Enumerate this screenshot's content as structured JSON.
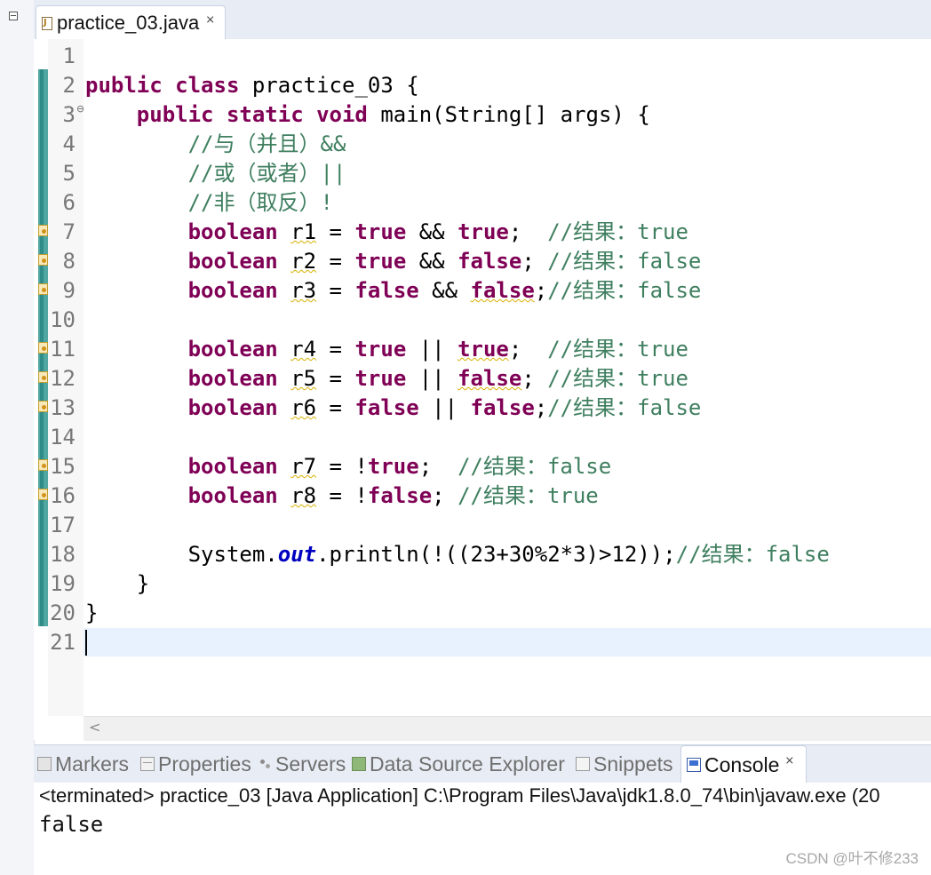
{
  "editor": {
    "tab_title": "practice_03.java",
    "tab_close": "⨯",
    "tab_icon": "java-file-icon",
    "lines": [
      {
        "n": "1",
        "segs": []
      },
      {
        "n": "2",
        "segs": [
          [
            "kw",
            "public class"
          ],
          [
            "",
            "practice_03 {"
          ]
        ]
      },
      {
        "n": "3",
        "fold": "⊖",
        "segs": [
          [
            "",
            "    "
          ],
          [
            "kw",
            "public static void"
          ],
          [
            "",
            "main(String[] args) {"
          ]
        ]
      },
      {
        "n": "4",
        "segs": [
          [
            "",
            "        "
          ],
          [
            "cm",
            "//与（并且）&&"
          ]
        ]
      },
      {
        "n": "5",
        "segs": [
          [
            "",
            "        "
          ],
          [
            "cm",
            "//或（或者）||"
          ]
        ]
      },
      {
        "n": "6",
        "segs": [
          [
            "",
            "        "
          ],
          [
            "cm",
            "//非（取反）!"
          ]
        ]
      },
      {
        "n": "7",
        "warn": true,
        "segs": [
          [
            "",
            "        "
          ],
          [
            "kw",
            "boolean"
          ],
          [
            "",
            " "
          ],
          [
            "wv",
            "r1"
          ],
          [
            "",
            " = "
          ],
          [
            "kw",
            "true"
          ],
          [
            "",
            " && "
          ],
          [
            "kw",
            "true"
          ],
          [
            "",
            ";  "
          ],
          [
            "cm",
            "//结果：true"
          ]
        ]
      },
      {
        "n": "8",
        "warn": true,
        "segs": [
          [
            "",
            "        "
          ],
          [
            "kw",
            "boolean"
          ],
          [
            "",
            " "
          ],
          [
            "wv",
            "r2"
          ],
          [
            "",
            " = "
          ],
          [
            "kw",
            "true"
          ],
          [
            "",
            " && "
          ],
          [
            "kw",
            "false"
          ],
          [
            "",
            "; "
          ],
          [
            "cm",
            "//结果：false"
          ]
        ]
      },
      {
        "n": "9",
        "warn": true,
        "segs": [
          [
            "",
            "        "
          ],
          [
            "kw",
            "boolean"
          ],
          [
            "",
            " "
          ],
          [
            "wv",
            "r3"
          ],
          [
            "",
            " = "
          ],
          [
            "kw",
            "false"
          ],
          [
            "",
            " && "
          ],
          [
            "kw wv",
            "false"
          ],
          [
            "",
            ";"
          ],
          [
            "cm",
            "//结果：false"
          ]
        ]
      },
      {
        "n": "10",
        "segs": []
      },
      {
        "n": "11",
        "warn": true,
        "segs": [
          [
            "",
            "        "
          ],
          [
            "kw",
            "boolean"
          ],
          [
            "",
            " "
          ],
          [
            "wv",
            "r4"
          ],
          [
            "",
            " = "
          ],
          [
            "kw",
            "true"
          ],
          [
            "",
            " || "
          ],
          [
            "kw wv",
            "true"
          ],
          [
            "",
            ";  "
          ],
          [
            "cm",
            "//结果：true"
          ]
        ]
      },
      {
        "n": "12",
        "warn": true,
        "segs": [
          [
            "",
            "        "
          ],
          [
            "kw",
            "boolean"
          ],
          [
            "",
            " "
          ],
          [
            "wv",
            "r5"
          ],
          [
            "",
            " = "
          ],
          [
            "kw",
            "true"
          ],
          [
            "",
            " || "
          ],
          [
            "kw wv",
            "false"
          ],
          [
            "",
            "; "
          ],
          [
            "cm",
            "//结果：true"
          ]
        ]
      },
      {
        "n": "13",
        "warn": true,
        "segs": [
          [
            "",
            "        "
          ],
          [
            "kw",
            "boolean"
          ],
          [
            "",
            " "
          ],
          [
            "wv",
            "r6"
          ],
          [
            "",
            " = "
          ],
          [
            "kw",
            "false"
          ],
          [
            "",
            " || "
          ],
          [
            "kw",
            "false"
          ],
          [
            "",
            ";"
          ],
          [
            "cm",
            "//结果：false"
          ]
        ]
      },
      {
        "n": "14",
        "segs": []
      },
      {
        "n": "15",
        "warn": true,
        "segs": [
          [
            "",
            "        "
          ],
          [
            "kw",
            "boolean"
          ],
          [
            "",
            " "
          ],
          [
            "wv",
            "r7"
          ],
          [
            "",
            " = !"
          ],
          [
            "kw",
            "true"
          ],
          [
            "",
            ";  "
          ],
          [
            "cm",
            "//结果：false"
          ]
        ]
      },
      {
        "n": "16",
        "warn": true,
        "segs": [
          [
            "",
            "        "
          ],
          [
            "kw",
            "boolean"
          ],
          [
            "",
            " "
          ],
          [
            "wv",
            "r8"
          ],
          [
            "",
            " = !"
          ],
          [
            "kw",
            "false"
          ],
          [
            "",
            "; "
          ],
          [
            "cm",
            "//结果：true"
          ]
        ]
      },
      {
        "n": "17",
        "segs": []
      },
      {
        "n": "18",
        "segs": [
          [
            "",
            "        System."
          ],
          [
            "fd",
            "out"
          ],
          [
            "",
            ".println(!((23+30%2*3)>12));"
          ],
          [
            "cm",
            "//结果：false"
          ]
        ]
      },
      {
        "n": "19",
        "segs": [
          [
            "",
            "    }"
          ]
        ]
      },
      {
        "n": "20",
        "segs": [
          [
            "",
            "}"
          ]
        ]
      },
      {
        "n": "21",
        "segs": []
      }
    ]
  },
  "bottom_panel": {
    "tabs": [
      {
        "label": "Markers",
        "icon": "markers-icon"
      },
      {
        "label": "Properties",
        "icon": "properties-icon"
      },
      {
        "label": "Servers",
        "icon": "servers-icon"
      },
      {
        "label": "Data Source Explorer",
        "icon": "data-source-explorer-icon"
      },
      {
        "label": "Snippets",
        "icon": "snippets-icon"
      },
      {
        "label": "Console",
        "icon": "console-icon",
        "active": true
      }
    ],
    "tab_close": "⨯",
    "console_status": "<terminated> practice_03 [Java Application] C:\\Program Files\\Java\\jdk1.8.0_74\\bin\\javaw.exe (20",
    "console_output": "false"
  },
  "watermark": "CSDN @叶不修233",
  "scroll_arrow": "<",
  "colors": {
    "keyword": "#7f0055",
    "comment": "#3f7f5f",
    "field": "#0000c0",
    "current_line": "#e8f2fe",
    "ruler": "#50a6a1"
  }
}
